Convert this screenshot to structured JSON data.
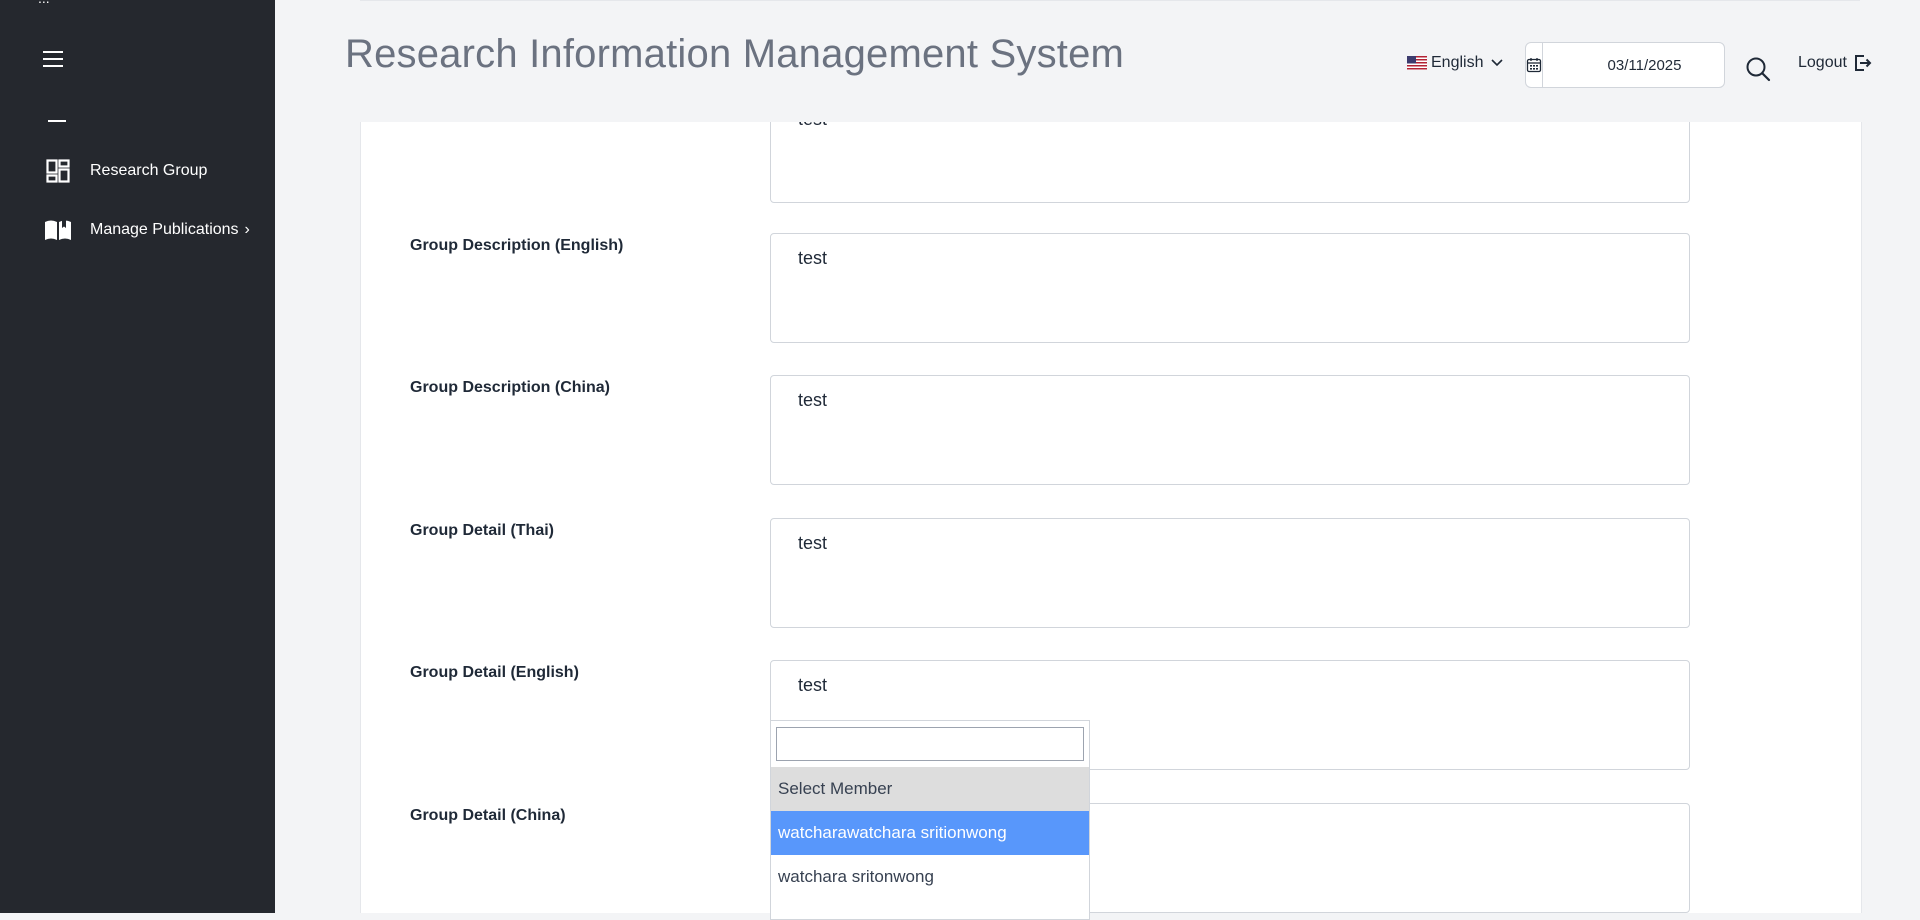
{
  "sidebar": {
    "top_text": "...",
    "items": [
      {
        "label": "Research Group",
        "icon": "dashboard-grid-icon"
      },
      {
        "label": "Manage Publications",
        "chevron": "›",
        "icon": "open-book-icon"
      }
    ]
  },
  "header": {
    "title": "Research Information Management System",
    "language": "English",
    "date": "03/11/2025",
    "logout_label": "Logout"
  },
  "form": {
    "top_partial_value": "test",
    "fields": [
      {
        "label": "Group Description (English)",
        "value": "test"
      },
      {
        "label": "Group Description (China)",
        "value": "test"
      },
      {
        "label": "Group Detail (Thai)",
        "value": "test"
      },
      {
        "label": "Group Detail (English)",
        "value": "test"
      },
      {
        "label": "Group Detail (China)",
        "value": ""
      }
    ]
  },
  "member_dropdown": {
    "search_value": "",
    "options": [
      {
        "label": "Select Member",
        "state": "placeholder"
      },
      {
        "label": "watcharawatchara sritionwong",
        "state": "highlighted"
      },
      {
        "label": "watchara sritonwong",
        "state": "normal"
      }
    ]
  },
  "colors": {
    "sidebar_bg": "#25282e",
    "highlight": "#5897fb",
    "page_bg": "#f3f4f6"
  }
}
